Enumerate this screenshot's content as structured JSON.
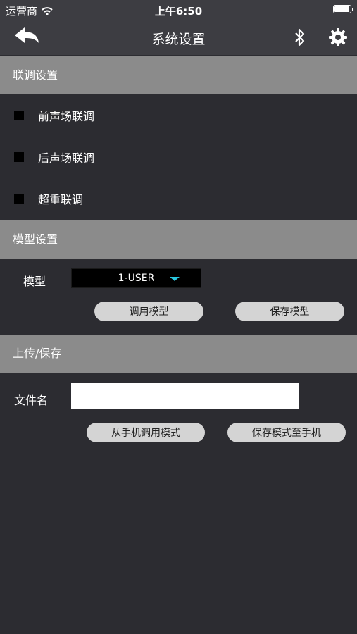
{
  "status": {
    "carrier": "运营商",
    "time": "上午6:50",
    "battery_level": 0.95
  },
  "nav": {
    "title": "系统设置"
  },
  "link_settings": {
    "header": "联调设置",
    "items": [
      {
        "label": "前声场联调"
      },
      {
        "label": "后声场联调"
      },
      {
        "label": "超重联调"
      }
    ]
  },
  "model_settings": {
    "header": "模型设置",
    "model_label": "模型",
    "model_value": "1-USER",
    "load_button": "调用模型",
    "save_button": "保存模型"
  },
  "upload_save": {
    "header": "上传/保存",
    "filename_label": "文件名",
    "filename_value": "",
    "load_from_phone_button": "从手机调用模式",
    "save_to_phone_button": "保存模式至手机"
  },
  "colors": {
    "accent": "#29c8e0",
    "header_bg": "#8b8b8b",
    "body_bg": "#2c2c31",
    "nav_bg": "#3d3d42"
  },
  "icons": [
    "wifi-icon",
    "battery-icon",
    "back-arrow-icon",
    "bluetooth-icon",
    "gear-icon",
    "dropdown-arrow-icon"
  ]
}
